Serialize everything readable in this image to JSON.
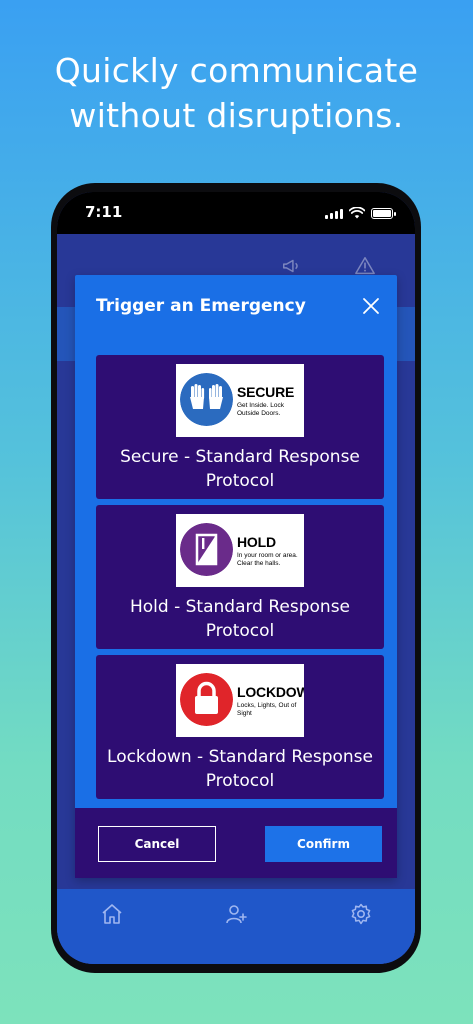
{
  "headline": {
    "line1": "Quickly communicate",
    "line2": "without disruptions."
  },
  "status_bar": {
    "time": "7:11",
    "icons": [
      "signal-icon",
      "wifi-icon",
      "battery-icon"
    ]
  },
  "header_icons": [
    "megaphone-icon",
    "warning-icon"
  ],
  "modal": {
    "title": "Trigger an Emergency",
    "close_icon": "close-icon",
    "options": [
      {
        "label": "Secure - Standard Response Protocol",
        "sign_title": "SECURE",
        "sign_subtitle": "Get Inside. Lock Outside Doors.",
        "sign_icon": "hands-up-icon",
        "sign_color": "#2b6bbf"
      },
      {
        "label": "Hold - Standard Response Protocol",
        "sign_title": "HOLD",
        "sign_subtitle": "In your room or area. Clear the halls.",
        "sign_icon": "door-icon",
        "sign_color": "#6a2b8a"
      },
      {
        "label": "Lockdown - Standard Response Protocol",
        "sign_title": "LOCKDOWN",
        "sign_subtitle": "Locks, Lights, Out of Sight",
        "sign_icon": "padlock-icon",
        "sign_color": "#e0252a"
      }
    ],
    "cancel_label": "Cancel",
    "confirm_label": "Confirm"
  },
  "bottom_nav": {
    "items": [
      "home-icon",
      "add-user-icon",
      "settings-icon"
    ]
  },
  "colors": {
    "modal_bg": "#1a6fe6",
    "option_bg": "#2e0d73",
    "confirm_bg": "#1d72e8",
    "nav_bg": "#2057c9"
  }
}
